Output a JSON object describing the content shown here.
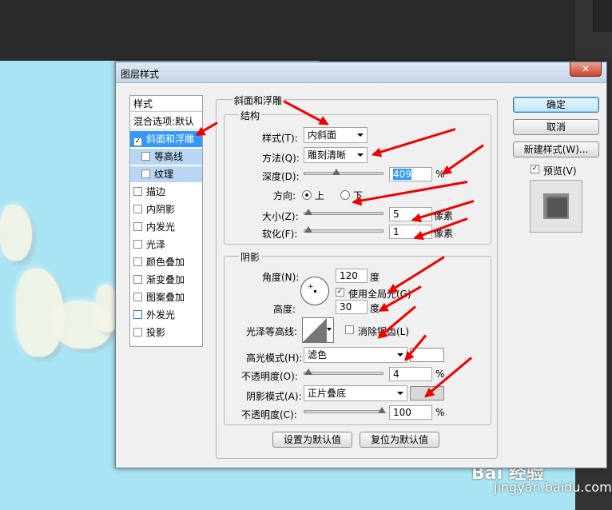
{
  "dialog": {
    "title": "图层样式",
    "close_symbol": "✕"
  },
  "style_list": {
    "header": "样式",
    "blend_default": "混合选项:默认",
    "items": [
      {
        "label": "斜面和浮雕",
        "checked": true
      },
      {
        "label": "等高线",
        "checked": false
      },
      {
        "label": "纹理",
        "checked": false
      },
      {
        "label": "描边",
        "checked": false
      },
      {
        "label": "内阴影",
        "checked": false
      },
      {
        "label": "内发光",
        "checked": false
      },
      {
        "label": "光泽",
        "checked": false
      },
      {
        "label": "颜色叠加",
        "checked": false
      },
      {
        "label": "渐变叠加",
        "checked": false
      },
      {
        "label": "图案叠加",
        "checked": false
      },
      {
        "label": "外发光",
        "checked": false
      },
      {
        "label": "投影",
        "checked": false
      }
    ]
  },
  "bevel": {
    "title": "斜面和浮雕",
    "structure": {
      "title": "结构",
      "style_label": "样式(T):",
      "style_value": "内斜面",
      "technique_label": "方法(Q):",
      "technique_value": "雕刻清晰",
      "depth_label": "深度(D):",
      "depth_value": "409",
      "depth_unit": "%",
      "direction_label": "方向:",
      "direction_up": "上",
      "direction_down": "下",
      "size_label": "大小(Z):",
      "size_value": "5",
      "size_unit": "像素",
      "soften_label": "软化(F):",
      "soften_value": "1",
      "soften_unit": "像素"
    },
    "shading": {
      "title": "阴影",
      "angle_label": "角度(N):",
      "angle_value": "120",
      "angle_unit": "度",
      "global_light_label": "使用全局光(G)",
      "altitude_label": "高度:",
      "altitude_value": "30",
      "altitude_unit": "度",
      "gloss_contour_label": "光泽等高线:",
      "anti_alias_label": "消除锯齿(L)",
      "highlight_mode_label": "高光模式(H):",
      "highlight_mode_value": "滤色",
      "highlight_opacity_label": "不透明度(O):",
      "highlight_opacity_value": "4",
      "highlight_opacity_unit": "%",
      "shadow_mode_label": "阴影模式(A):",
      "shadow_mode_value": "正片叠底",
      "shadow_opacity_label": "不透明度(C):",
      "shadow_opacity_value": "100",
      "shadow_opacity_unit": "%"
    },
    "set_default": "设置为默认值",
    "reset_default": "复位为默认值"
  },
  "side_buttons": {
    "ok": "确定",
    "cancel": "取消",
    "new_style": "新建样式(W)...",
    "preview": "预览(V)"
  },
  "watermark": {
    "brand": "Bai  经验",
    "url": "jingyan.baidu.com"
  },
  "colors": {
    "accent": "#3399ff",
    "annotation_arrow": "#e00000",
    "canvas": "#a9e4f2"
  }
}
